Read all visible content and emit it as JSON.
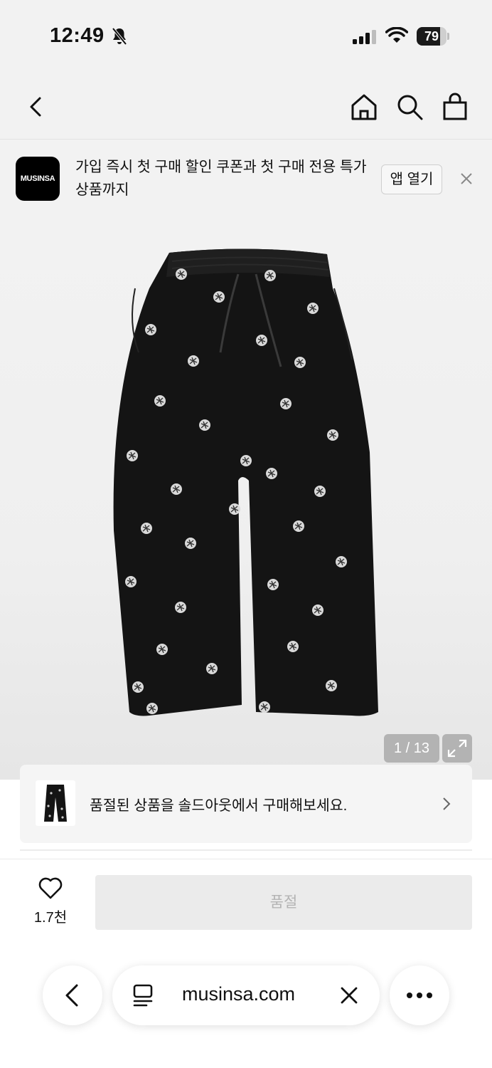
{
  "status_bar": {
    "time": "12:49",
    "battery_level": "79",
    "icons": [
      "bell-slash-icon",
      "signal-icon",
      "wifi-icon",
      "battery-icon"
    ]
  },
  "nav": {
    "icons": [
      "back-arrow-icon",
      "home-icon",
      "search-icon",
      "shopping-bag-icon"
    ]
  },
  "app_banner": {
    "logo_text": "MUSINSA",
    "message": "가입 즉시 첫 구매 할인 쿠폰과 첫 구매 전용 특가 상품까지",
    "open_button": "앱 열기"
  },
  "gallery": {
    "counter": "1 / 13",
    "product_color": "#141414"
  },
  "soldout_notice": {
    "text": "품절된 상품을 솔드아웃에서 구매해보세요."
  },
  "purchase_bar": {
    "like_count": "1.7천",
    "soldout_label": "품절"
  },
  "browser": {
    "url": "musinsa.com"
  },
  "colors": {
    "background": "#f2f2f2",
    "disabled_button": "#ebebeb",
    "disabled_text": "#b3b3b3"
  }
}
